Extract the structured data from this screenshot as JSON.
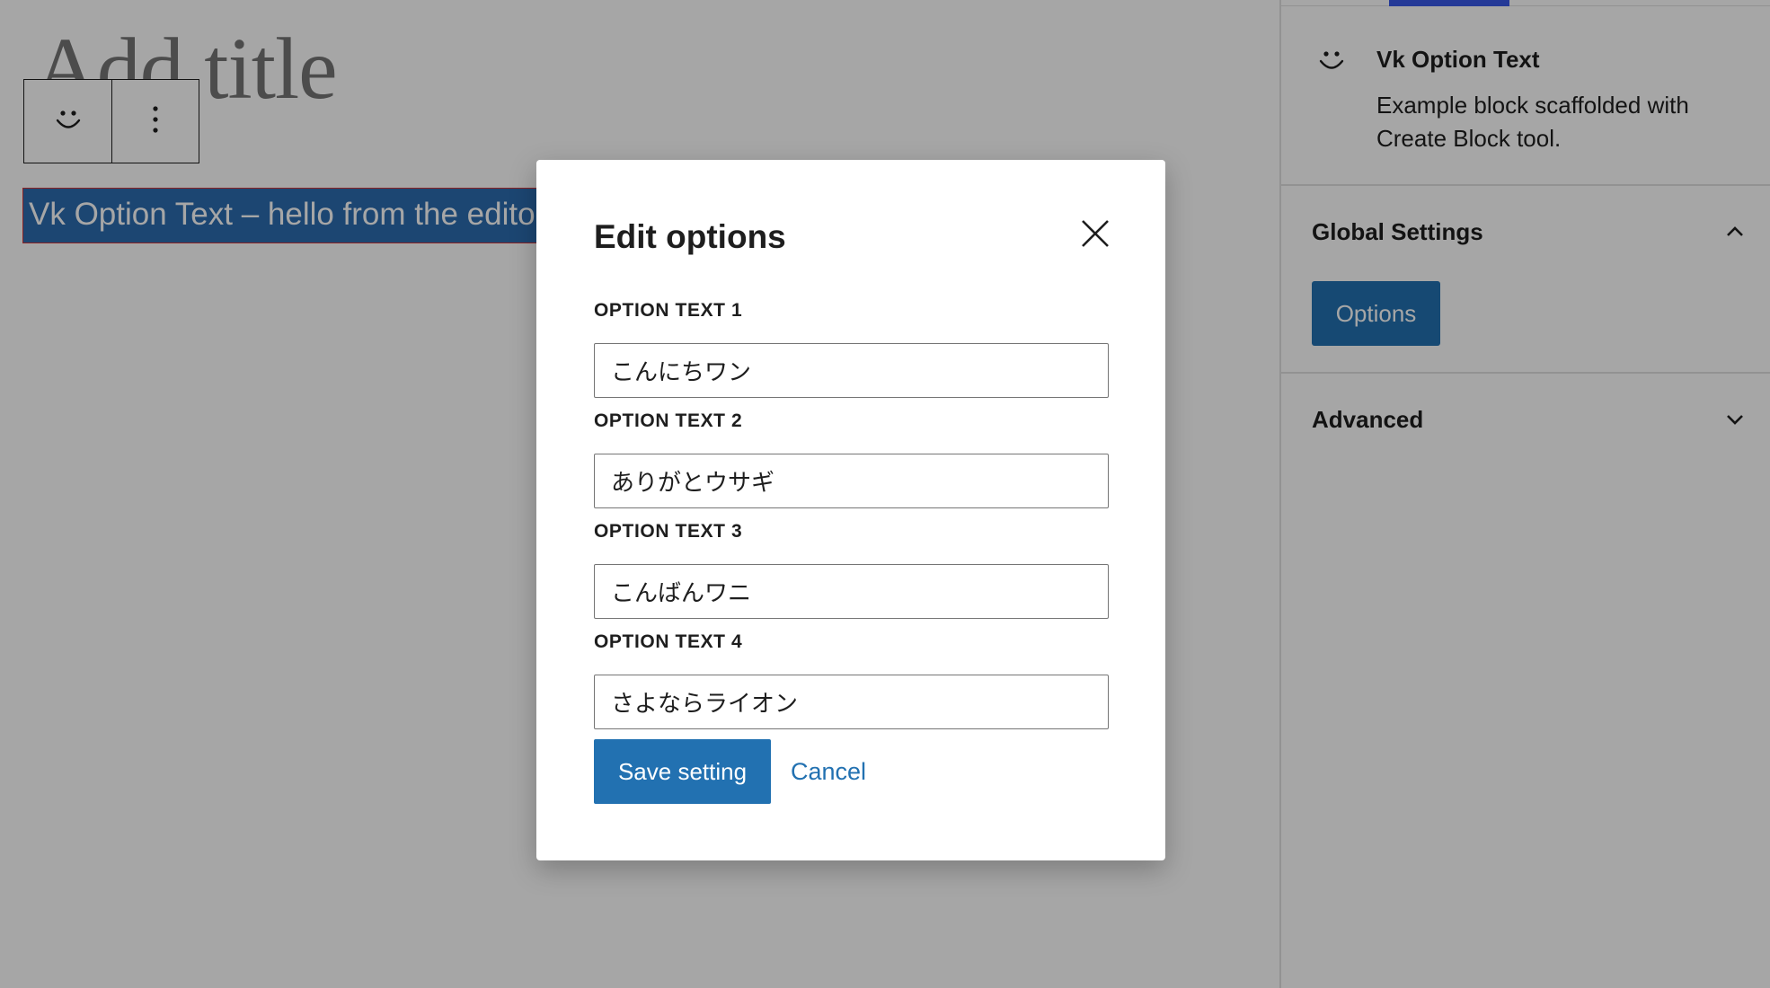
{
  "editor": {
    "title_placeholder": "Add title",
    "block_text": "Vk Option Text – hello from the editor!"
  },
  "block_toolbar": {
    "block_icon": "smiley-icon",
    "options_icon": "more-vertical-icon"
  },
  "sidebar": {
    "block_card": {
      "icon": "smiley-icon",
      "title": "Vk Option Text",
      "description": "Example block scaffolded with Create Block tool."
    },
    "panels": [
      {
        "title": "Global Settings",
        "expanded": true,
        "button_label": "Options"
      },
      {
        "title": "Advanced",
        "expanded": false
      }
    ]
  },
  "modal": {
    "title": "Edit options",
    "close_icon": "close-icon",
    "fields": [
      {
        "label": "OPTION TEXT 1",
        "value": "こんにちワン"
      },
      {
        "label": "OPTION TEXT 2",
        "value": "ありがとウサギ"
      },
      {
        "label": "OPTION TEXT 3",
        "value": "こんばんワニ"
      },
      {
        "label": "OPTION TEXT 4",
        "value": "さよならライオン"
      }
    ],
    "save_label": "Save setting",
    "cancel_label": "Cancel"
  },
  "colors": {
    "accent": "#2271b1",
    "overlay": "rgba(0,0,0,0.35)",
    "selection": "#2b6cb0"
  }
}
